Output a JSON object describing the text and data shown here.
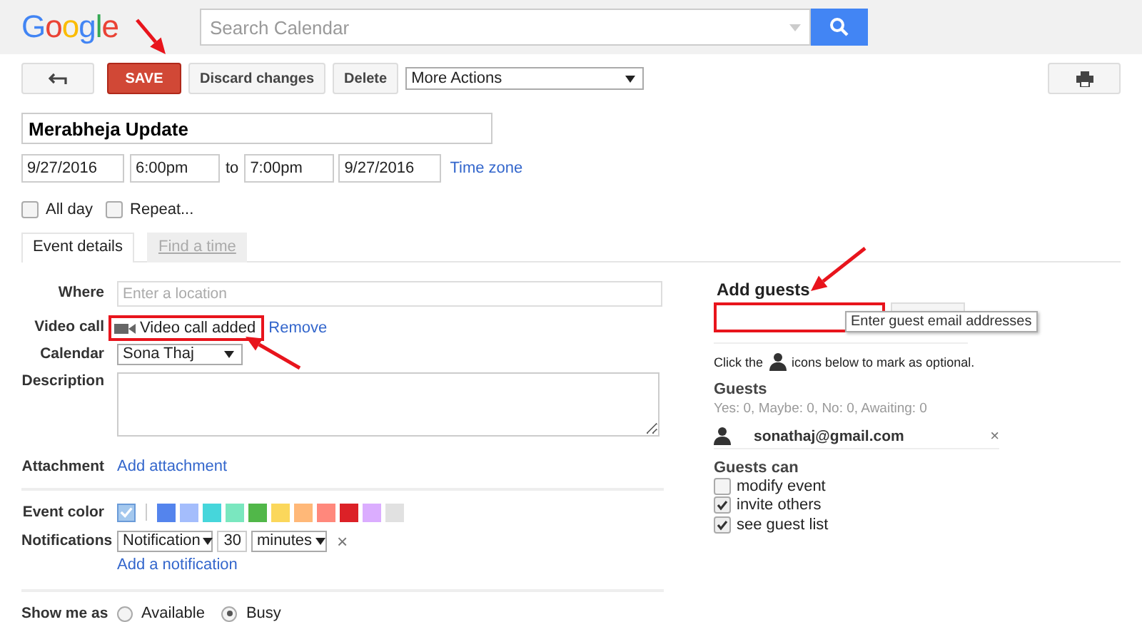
{
  "header": {
    "logo": "Google",
    "search": {
      "placeholder": "Search Calendar"
    }
  },
  "toolbar": [
    {
      "kind": "back"
    },
    {
      "kind": "primary",
      "label": "SAVE",
      "annotated": true
    },
    {
      "kind": "plain",
      "label": "Discard changes"
    },
    {
      "kind": "plain",
      "label": "Delete"
    },
    {
      "kind": "dropdown",
      "label": "More Actions"
    },
    {
      "kind": "print"
    }
  ],
  "event": {
    "title": "Merabheja Update",
    "start_date": "9/27/2016",
    "start_time": "6:00pm",
    "to": "to",
    "end_time": "7:00pm",
    "end_date": "9/27/2016",
    "time_zone": "Time zone",
    "options": [
      {
        "label": "All day",
        "checked": false
      },
      {
        "label": "Repeat...",
        "checked": false
      }
    ]
  },
  "tabs": [
    {
      "label": "Event details",
      "selected": true
    },
    {
      "label": "Find a time",
      "selected": false
    }
  ],
  "details": {
    "where": {
      "label": "Where",
      "placeholder": "Enter a location"
    },
    "video_call": {
      "label": "Video call",
      "status": "Video call added",
      "action": "Remove",
      "annotated": true
    },
    "calendar": {
      "label": "Calendar",
      "value": "Sona Thaj"
    },
    "description": {
      "label": "Description"
    },
    "attachment": {
      "label": "Attachment",
      "action": "Add attachment"
    },
    "event_color": {
      "label": "Event color",
      "colors": [
        {
          "color": "#a4c8ee",
          "selected": true
        },
        {
          "color": "#5484ed",
          "selected": false
        },
        {
          "color": "#a4bdfc",
          "selected": false
        },
        {
          "color": "#46d6db",
          "selected": false
        },
        {
          "color": "#7ae7bf",
          "selected": false
        },
        {
          "color": "#51b749",
          "selected": false
        },
        {
          "color": "#fbd75b",
          "selected": false
        },
        {
          "color": "#ffb878",
          "selected": false
        },
        {
          "color": "#ff887c",
          "selected": false
        },
        {
          "color": "#dc2127",
          "selected": false
        },
        {
          "color": "#dbadff",
          "selected": false
        },
        {
          "color": "#e1e1e1",
          "selected": false
        }
      ]
    },
    "notifications": {
      "label": "Notifications",
      "type": "Notification",
      "amount": "30",
      "unit": "minutes",
      "remove": "×",
      "add": "Add a notification"
    },
    "show_me_as": {
      "label": "Show me as",
      "options": [
        {
          "label": "Available",
          "selected": false
        },
        {
          "label": "Busy",
          "selected": true
        }
      ]
    }
  },
  "guests_panel": {
    "title": "Add guests",
    "field": {
      "annotated": true
    },
    "tooltip": "Enter guest email addresses",
    "hint": {
      "before": "Click the",
      "after": "icons below to mark as optional."
    },
    "guests_title": "Guests",
    "summary": "Yes: 0, Maybe: 0, No: 0, Awaiting: 0",
    "guests": [
      {
        "email": "sonathaj@gmail.com",
        "remove": "×"
      }
    ],
    "permissions_title": "Guests can",
    "permissions": [
      {
        "label": "modify event",
        "checked": false
      },
      {
        "label": "invite others",
        "checked": true
      },
      {
        "label": "see guest list",
        "checked": true
      }
    ]
  }
}
